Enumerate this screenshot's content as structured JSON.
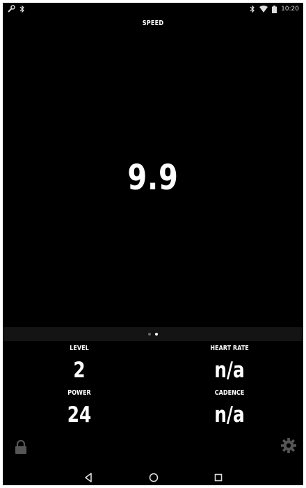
{
  "statusbar": {
    "left_icons": [
      "wrench-icon",
      "bluetooth-icon"
    ],
    "right_icons": [
      "bluetooth-icon",
      "wifi-icon",
      "battery-icon"
    ],
    "time": "10:20"
  },
  "screen": {
    "title": "SPEED",
    "main_value": "9.9"
  },
  "pager": {
    "count": 2,
    "active_index": 1
  },
  "metrics": {
    "level": {
      "label": "LEVEL",
      "value": "2"
    },
    "heart_rate": {
      "label": "HEART RATE",
      "value": "n/a"
    },
    "power": {
      "label": "POWER",
      "value": "24"
    },
    "cadence": {
      "label": "CADENCE",
      "value": "n/a"
    }
  },
  "controls": {
    "lock_icon": "lock-icon",
    "settings_icon": "gear-icon"
  },
  "navbar": {
    "buttons": [
      "back-icon",
      "home-icon",
      "recents-icon"
    ]
  },
  "colors": {
    "background": "#000000",
    "text": "#ffffff",
    "muted_icon": "#555555",
    "pager_strip": "#141414"
  }
}
